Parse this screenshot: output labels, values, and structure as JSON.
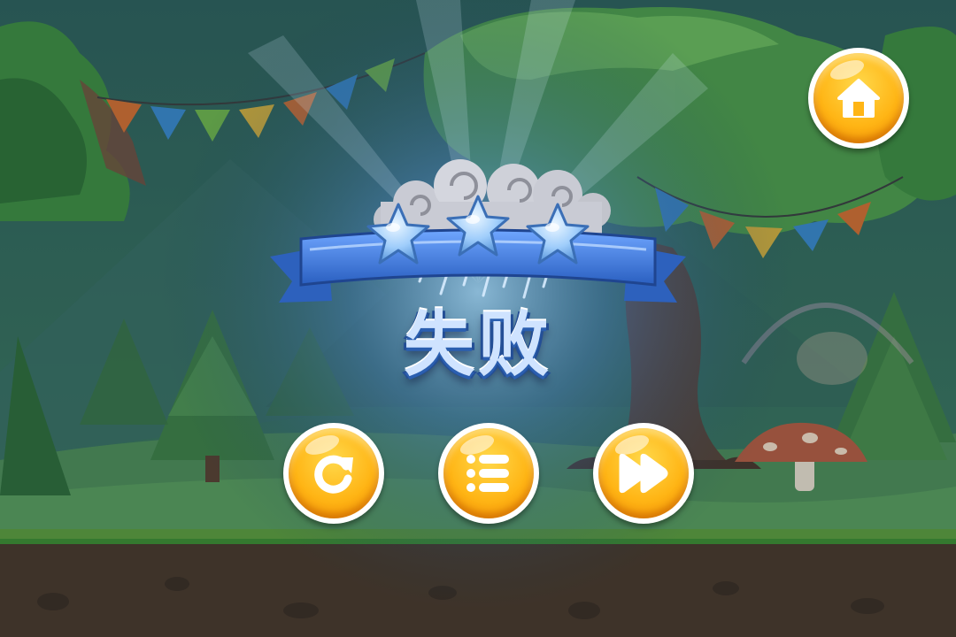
{
  "screen": {
    "type": "level-result",
    "result_title": "失败",
    "stars_earned": 0,
    "stars_total": 3
  },
  "buttons": {
    "home": {
      "icon": "home-icon"
    },
    "replay": {
      "icon": "replay-icon"
    },
    "menu": {
      "icon": "level-list-icon"
    },
    "next": {
      "icon": "next-level-icon"
    }
  },
  "colors": {
    "button_orange": "#ffb515",
    "button_rim": "#ffffff",
    "ribbon_blue": "#3f78d8",
    "star_blue": "#a9d3ff",
    "title_fill": "#cfe3ff",
    "ground_soil": "#4a3527",
    "grass_green": "#5d9a3a"
  }
}
